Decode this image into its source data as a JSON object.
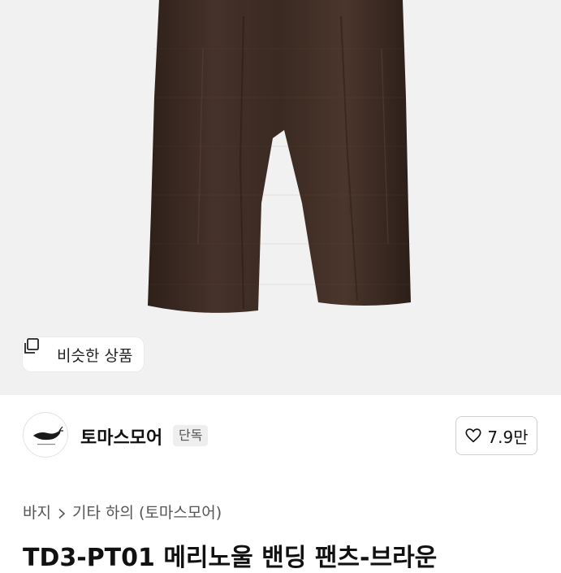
{
  "similar_products": {
    "label": "비슷한 상품"
  },
  "seller": {
    "name": "토마스모어",
    "badge": "단독"
  },
  "like": {
    "count": "7.9만"
  },
  "breadcrumb": {
    "items": [
      "바지",
      "기타 하의 (토마스모어)"
    ]
  },
  "product": {
    "title": "TD3-PT01 메리노울 밴딩 팬츠-브라운"
  },
  "colors": {
    "hero_bg": "#f1f1f1",
    "pants": "#3d2b22",
    "badge_bg": "#eeeeee"
  }
}
